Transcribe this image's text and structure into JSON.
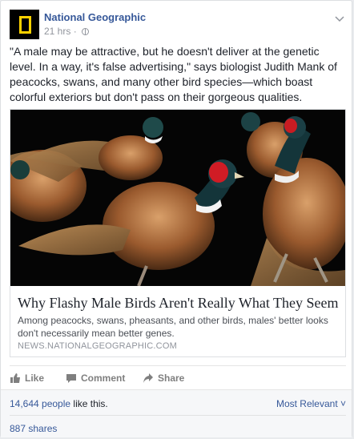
{
  "post": {
    "page_name": "National Geographic",
    "time": "21 hrs",
    "separator": "·",
    "text": "\"A male may be attractive, but he doesn't deliver at the genetic level. In a way, it's false advertising,\" says biologist Judith Mank of peacocks, swans, and many other bird species—which boast colorful exteriors but don't pass on their gorgeous qualities."
  },
  "link_preview": {
    "title": "Why Flashy Male Birds Aren't Really What They Seem",
    "description": "Among peacocks, swans, pheasants, and other birds, males' better looks don't necessarily mean better genes.",
    "domain": "NEWS.NATIONALGEOGRAPHIC.COM"
  },
  "actions": {
    "like": "Like",
    "comment": "Comment",
    "share": "Share"
  },
  "footer": {
    "likes_count": "14,644 people",
    "likes_suffix": " like this.",
    "sort": "Most Relevant ˅",
    "shares": "887 shares"
  },
  "colors": {
    "link": "#365899",
    "brand_yellow": "#ffd200",
    "muted": "#90949c"
  },
  "icons": [
    "chevron-down-icon",
    "globe-icon",
    "like-icon",
    "comment-icon",
    "share-icon"
  ]
}
